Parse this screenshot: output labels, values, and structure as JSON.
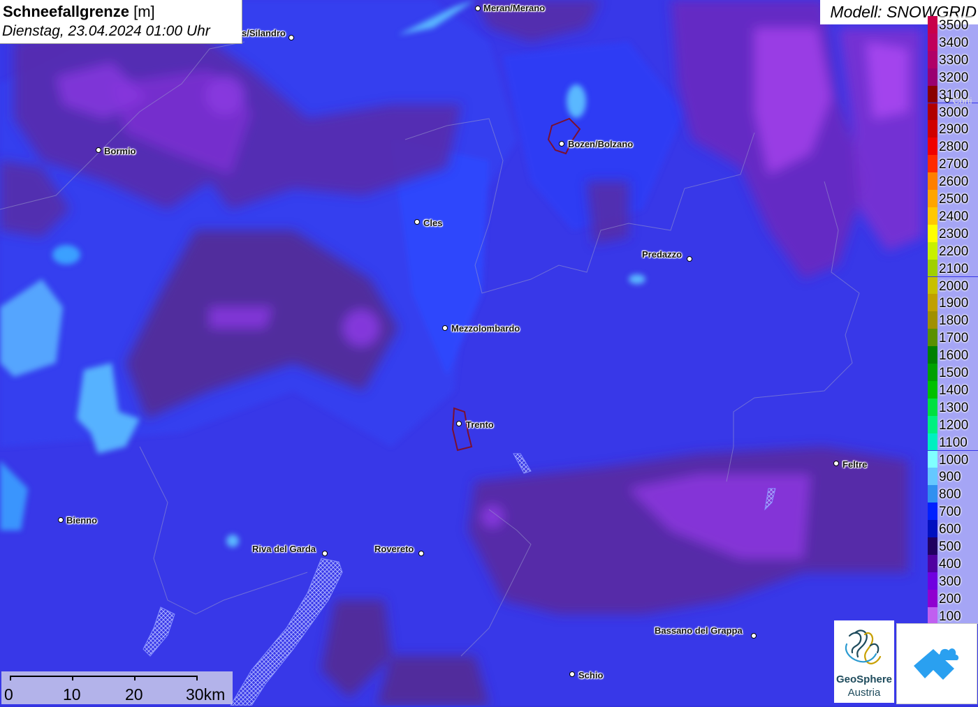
{
  "title": {
    "variable": "Schneefallgrenze",
    "unit": "[m]",
    "datetime": "Dienstag, 23.04.2024 01:00 Uhr"
  },
  "model": "Modell: SNOWGRID",
  "legend": {
    "items": [
      {
        "label": "3500",
        "color": "#c8004a"
      },
      {
        "label": "3400",
        "color": "#c0005a"
      },
      {
        "label": "3300",
        "color": "#b00068"
      },
      {
        "label": "3200",
        "color": "#9a0070"
      },
      {
        "label": "3100",
        "color": "#8a0000"
      },
      {
        "label": "3000",
        "color": "#b00000"
      },
      {
        "label": "2900",
        "color": "#d00000"
      },
      {
        "label": "2800",
        "color": "#f00000"
      },
      {
        "label": "2700",
        "color": "#ff2a00"
      },
      {
        "label": "2600",
        "color": "#ff7f00"
      },
      {
        "label": "2500",
        "color": "#ffa500"
      },
      {
        "label": "2400",
        "color": "#ffc800"
      },
      {
        "label": "2300",
        "color": "#ffff00"
      },
      {
        "label": "2200",
        "color": "#c8f000"
      },
      {
        "label": "2100",
        "color": "#a0d000"
      },
      {
        "label": "2000",
        "color": "#c8c000"
      },
      {
        "label": "1900",
        "color": "#c0a000"
      },
      {
        "label": "1800",
        "color": "#a09000"
      },
      {
        "label": "1700",
        "color": "#5a9000"
      },
      {
        "label": "1600",
        "color": "#008000"
      },
      {
        "label": "1500",
        "color": "#00a000"
      },
      {
        "label": "1400",
        "color": "#00c000"
      },
      {
        "label": "1300",
        "color": "#00e040"
      },
      {
        "label": "1200",
        "color": "#00f080"
      },
      {
        "label": "1100",
        "color": "#00f0c0"
      },
      {
        "label": "1000",
        "color": "#80ffff"
      },
      {
        "label": "900",
        "color": "#66c8ff"
      },
      {
        "label": "800",
        "color": "#3090f0"
      },
      {
        "label": "700",
        "color": "#0020ff"
      },
      {
        "label": "600",
        "color": "#0010c0"
      },
      {
        "label": "500",
        "color": "#200060"
      },
      {
        "label": "400",
        "color": "#5000a0"
      },
      {
        "label": "300",
        "color": "#7000e0"
      },
      {
        "label": "200",
        "color": "#9000d0"
      },
      {
        "label": "100",
        "color": "#c060f0"
      }
    ]
  },
  "cities": [
    {
      "name": "Meran/Merano"
    },
    {
      "name": "s/Silandro"
    },
    {
      "name": "Bormio"
    },
    {
      "name": "Bozen/Bolzano"
    },
    {
      "name": "Cles"
    },
    {
      "name": "Predazzo"
    },
    {
      "name": "Mezzolombardo"
    },
    {
      "name": "Trento"
    },
    {
      "name": "Feltre"
    },
    {
      "name": "Bienno"
    },
    {
      "name": "Riva del Garda"
    },
    {
      "name": "Rovereto"
    },
    {
      "name": "Bassano del Grappa"
    },
    {
      "name": "Schio"
    },
    {
      "name": "Corti"
    }
  ],
  "scale": {
    "labels": [
      "0",
      "10",
      "20",
      "30km"
    ]
  },
  "logos": {
    "geosphere_name": "GeoSphere",
    "geosphere_sub": "Austria"
  }
}
